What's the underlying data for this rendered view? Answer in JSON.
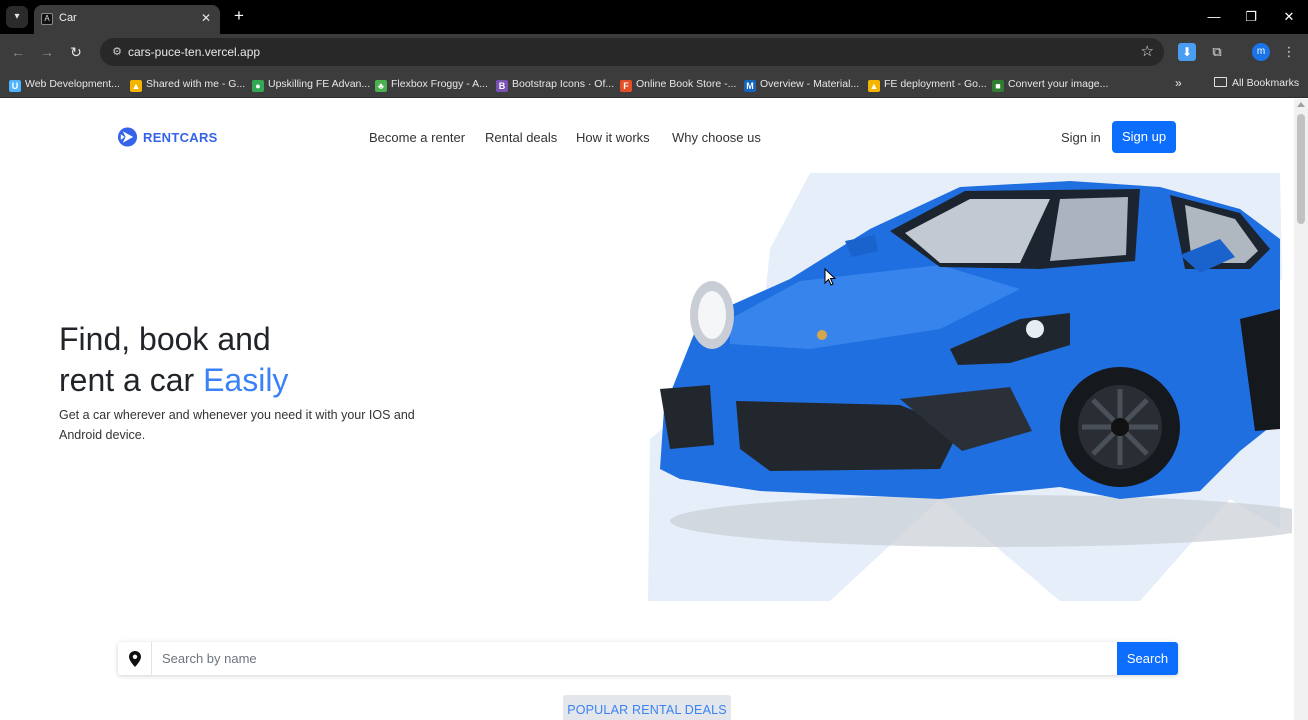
{
  "browser": {
    "tab": {
      "favicon": "A",
      "title": "Car"
    },
    "url": "cars-puce-ten.vercel.app",
    "profile_initial": "m",
    "bookmarks": [
      {
        "label": "Web Development...",
        "icon_color": "#4fb3ff",
        "icon_glyph": "U"
      },
      {
        "label": "Shared with me - G...",
        "icon_color": "#f4b400",
        "icon_glyph": "▲"
      },
      {
        "label": "Upskilling FE Advan...",
        "icon_color": "#34a853",
        "icon_glyph": "●"
      },
      {
        "label": "Flexbox Froggy - A...",
        "icon_color": "#4caf50",
        "icon_glyph": "♣"
      },
      {
        "label": "Bootstrap Icons · Of...",
        "icon_color": "#7952b3",
        "icon_glyph": "B"
      },
      {
        "label": "Online Book Store -...",
        "icon_color": "#e44d26",
        "icon_glyph": "F"
      },
      {
        "label": "Overview - Material...",
        "icon_color": "#1565c0",
        "icon_glyph": "M"
      },
      {
        "label": "FE deployment - Go...",
        "icon_color": "#f4b400",
        "icon_glyph": "▲"
      },
      {
        "label": "Convert your image...",
        "icon_color": "#2e7d32",
        "icon_glyph": "■"
      }
    ],
    "all_bookmarks": "All Bookmarks"
  },
  "site": {
    "brand": "RENTCARS",
    "nav": [
      "Become a renter",
      "Rental deals",
      "How it works",
      "Why choose us"
    ],
    "sign_in": "Sign in",
    "sign_up": "Sign up",
    "hero": {
      "title_line1": "Find, book and",
      "title_line2": "rent a car ",
      "title_accent": "Easily",
      "subtitle": "Get a car wherever and whenever you need it with your IOS and Android device."
    },
    "search": {
      "placeholder": "Search by name",
      "button": "Search"
    },
    "popular_badge": "POPULAR RENTAL DEALS"
  },
  "colors": {
    "primary": "#0d6efd",
    "brand": "#3563e9",
    "accent": "#3b82f6",
    "car_blue": "#1f6fe0"
  }
}
